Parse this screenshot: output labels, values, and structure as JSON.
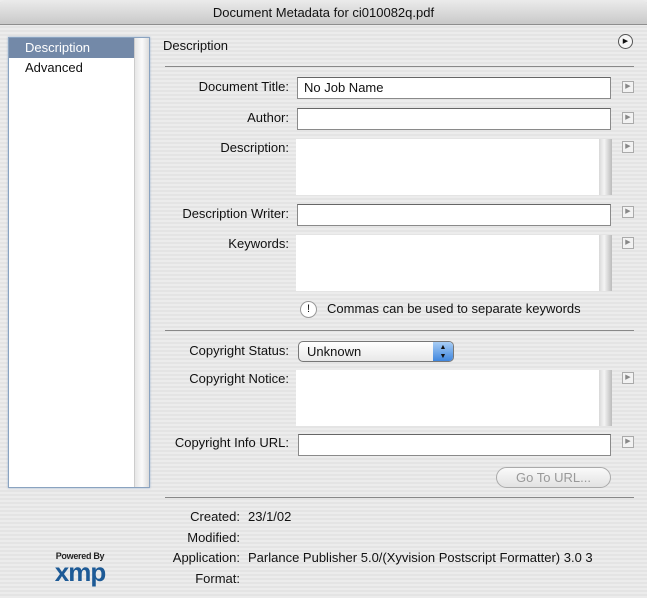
{
  "window": {
    "title": "Document Metadata for ci010082q.pdf"
  },
  "sidebar": {
    "items": [
      {
        "label": "Description",
        "selected": true
      },
      {
        "label": "Advanced",
        "selected": false
      }
    ]
  },
  "panel": {
    "header": "Description",
    "menu_icon": "circle-play-icon"
  },
  "fields": {
    "document_title": {
      "label": "Document Title:",
      "value": "No Job Name"
    },
    "author": {
      "label": "Author:",
      "value": ""
    },
    "description": {
      "label": "Description:",
      "value": ""
    },
    "description_writer": {
      "label": "Description Writer:",
      "value": ""
    },
    "keywords": {
      "label": "Keywords:",
      "value": ""
    },
    "keywords_hint": "Commas can be used to separate keywords",
    "copyright_status": {
      "label": "Copyright Status:",
      "value": "Unknown"
    },
    "copyright_notice": {
      "label": "Copyright Notice:",
      "value": ""
    },
    "copyright_url": {
      "label": "Copyright Info URL:",
      "value": ""
    },
    "go_to_url": "Go To URL..."
  },
  "meta": {
    "created": {
      "label": "Created:",
      "value": "23/1/02"
    },
    "modified": {
      "label": "Modified:",
      "value": ""
    },
    "application": {
      "label": "Application:",
      "value": "Parlance Publisher 5.0/(Xyvision Postscript Formatter) 3.0 3"
    },
    "format": {
      "label": "Format:",
      "value": ""
    }
  },
  "logo": {
    "powered": "Powered By",
    "brand": "xmp"
  }
}
